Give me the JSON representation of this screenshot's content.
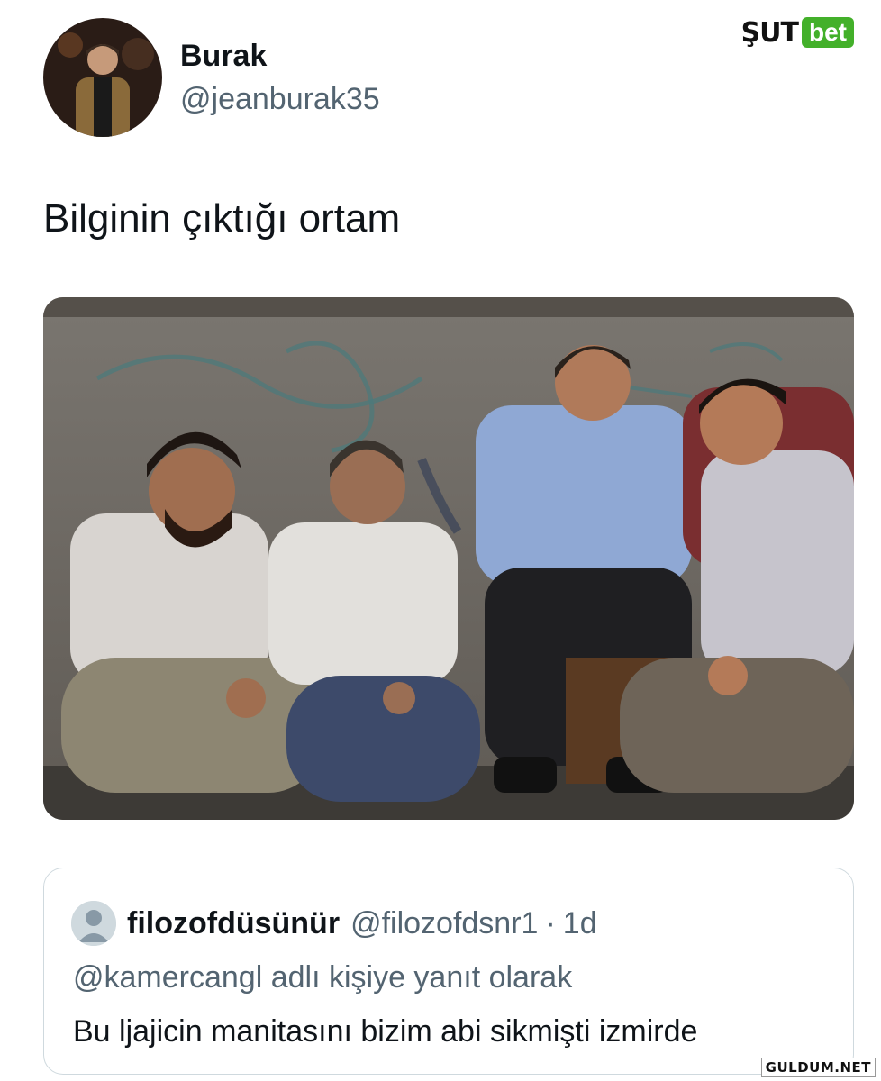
{
  "tweet": {
    "author_name": "Burak",
    "author_handle": "@jeanburak35",
    "text": "Bilginin çıktığı ortam"
  },
  "brand": {
    "sut": "ŞUT",
    "bet": "bet",
    "accent_color": "#43b02a"
  },
  "quote": {
    "author_name": "filozofdüsünür",
    "author_handle": "@filozofdsnr1",
    "separator": "·",
    "time": "1d",
    "reply_to": "@kamercangl adlı kişiye yanıt olarak",
    "text": "Bu ljajicin manitasını bizim abi sikmişti izmirde"
  },
  "watermark": "GULDUM.NET",
  "colors": {
    "text_primary": "#0f1419",
    "text_secondary": "#536471",
    "border": "#cfd9de"
  }
}
